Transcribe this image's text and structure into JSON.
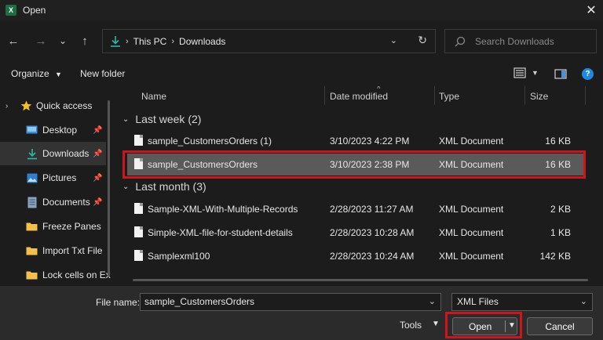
{
  "window": {
    "title": "Open",
    "app_icon": "excel-icon",
    "close_glyph": "✕"
  },
  "nav": {
    "back_glyph": "←",
    "forward_glyph": "→",
    "recent_glyph": "⌄",
    "up_glyph": "↑",
    "breadcrumb": [
      "This PC",
      "Downloads"
    ],
    "search_placeholder": "Search Downloads"
  },
  "toolbar": {
    "organize_label": "Organize",
    "new_folder_label": "New folder"
  },
  "sidebar": {
    "items": [
      {
        "label": "Quick access",
        "icon": "star-icon",
        "pinned": false
      },
      {
        "label": "Desktop",
        "icon": "desktop-icon",
        "pinned": true
      },
      {
        "label": "Downloads",
        "icon": "download-icon",
        "pinned": true,
        "active": true
      },
      {
        "label": "Pictures",
        "icon": "pictures-icon",
        "pinned": true
      },
      {
        "label": "Documents",
        "icon": "documents-icon",
        "pinned": true
      },
      {
        "label": "Freeze Panes",
        "icon": "folder-icon",
        "pinned": false
      },
      {
        "label": "Import Txt File",
        "icon": "folder-icon",
        "pinned": false
      },
      {
        "label": "Lock cells on Ex",
        "icon": "folder-icon",
        "pinned": false
      }
    ]
  },
  "columns": {
    "name": "Name",
    "date_modified": "Date modified",
    "type": "Type",
    "size": "Size"
  },
  "groups": [
    {
      "label": "Last week (2)",
      "files": [
        {
          "name": "sample_CustomersOrders (1)",
          "date": "3/10/2023 4:22 PM",
          "type": "XML Document",
          "size": "16 KB"
        },
        {
          "name": "sample_CustomersOrders",
          "date": "3/10/2023 2:38 PM",
          "type": "XML Document",
          "size": "16 KB",
          "selected": true
        }
      ]
    },
    {
      "label": "Last month (3)",
      "files": [
        {
          "name": "Sample-XML-With-Multiple-Records",
          "date": "2/28/2023 11:27 AM",
          "type": "XML Document",
          "size": "2 KB"
        },
        {
          "name": "Simple-XML-file-for-student-details",
          "date": "2/28/2023 10:28 AM",
          "type": "XML Document",
          "size": "1 KB"
        },
        {
          "name": "Samplexml100",
          "date": "2/28/2023 10:24 AM",
          "type": "XML Document",
          "size": "142 KB"
        }
      ]
    }
  ],
  "footer": {
    "file_name_label": "File name:",
    "file_name_value": "sample_CustomersOrders",
    "file_type_value": "XML Files",
    "tools_label": "Tools",
    "open_label": "Open",
    "cancel_label": "Cancel"
  },
  "colors": {
    "background": "#1c1c1c",
    "footer_bg": "#2b2b2b",
    "selection": "#5a5a5a",
    "highlight_annotation": "#d0141d",
    "excel_green": "#1d6f42",
    "accent_blue": "#1e88e5"
  }
}
